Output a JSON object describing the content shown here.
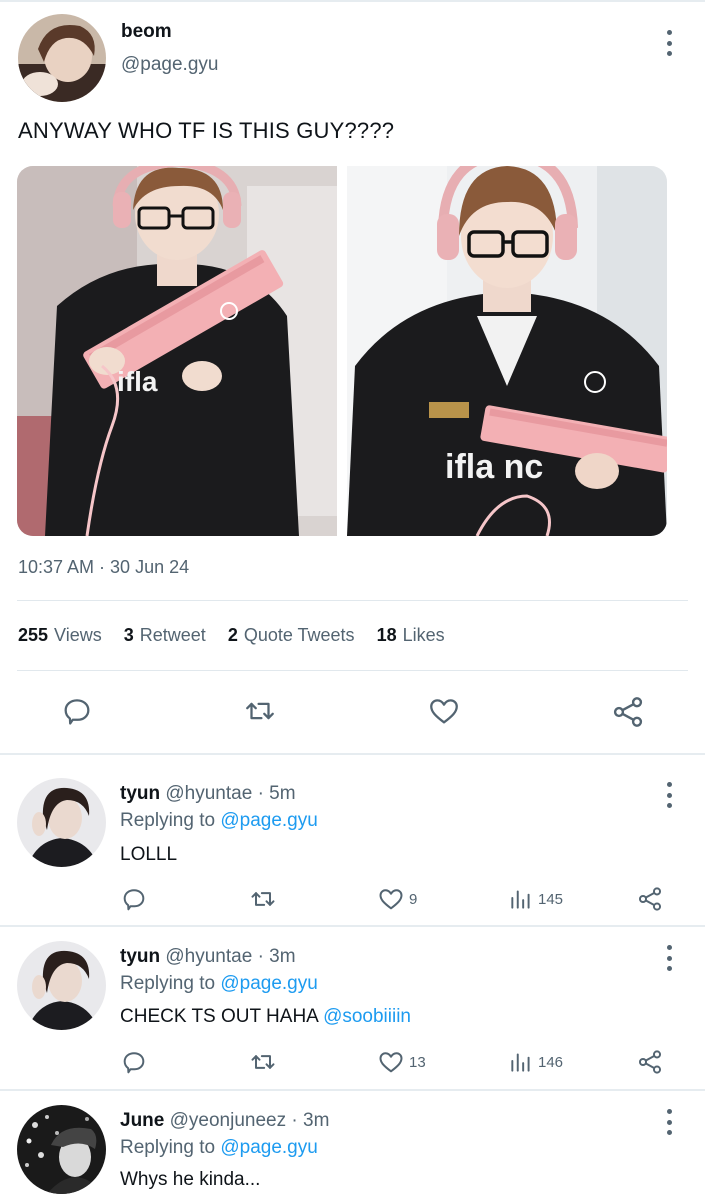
{
  "main_tweet": {
    "display_name": "beom",
    "handle": "@page.gyu",
    "text": "ANYWAY WHO TF IS THIS GUY????",
    "timestamp": "10:37 AM · 30 Jun 24",
    "stats": [
      {
        "count": "255",
        "label": "Views"
      },
      {
        "count": "3",
        "label": "Retweet"
      },
      {
        "count": "2",
        "label": "Quote Tweets"
      },
      {
        "count": "18",
        "label": "Likes"
      }
    ],
    "actions": [
      "reply-icon",
      "retweet-icon",
      "like-icon",
      "share-icon"
    ]
  },
  "replies": [
    {
      "display_name": "tyun",
      "handle": "@hyuntae",
      "age": "· 5m",
      "replying_prefix": "Replying to",
      "replying_to": "@page.gyu",
      "text": "LOLLL",
      "mention": "",
      "likes": "9",
      "views": "145"
    },
    {
      "display_name": "tyun",
      "handle": "@hyuntae",
      "age": "· 3m",
      "replying_prefix": "Replying to",
      "replying_to": "@page.gyu",
      "text": "CHECK TS OUT HAHA ",
      "mention": "@soobiiiin",
      "likes": "13",
      "views": "146"
    },
    {
      "display_name": "June",
      "handle": "@yeonjuneez",
      "age": "· 3m",
      "replying_prefix": "Replying to",
      "replying_to": "@page.gyu",
      "text": "Whys he kinda...",
      "mention": "",
      "likes": "",
      "views": ""
    }
  ],
  "colors": {
    "text": "#0f1419",
    "secondary": "#536471",
    "link": "#1d9bf0",
    "divider": "#e6ecf0"
  }
}
